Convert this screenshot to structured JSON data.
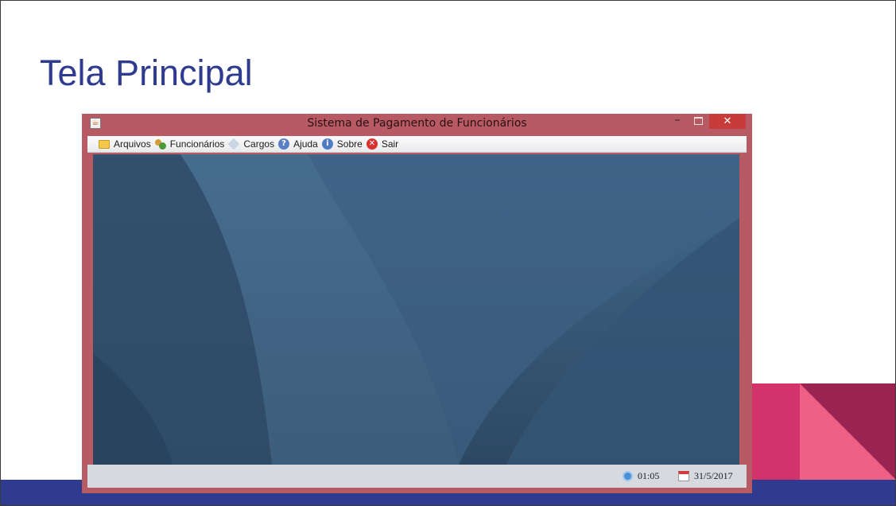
{
  "slide": {
    "title": "Tela Principal"
  },
  "window": {
    "title": "Sistema de Pagamento de Funcionários",
    "close_glyph": "✕",
    "minimize_glyph": "–"
  },
  "menu": {
    "items": [
      {
        "label": "Arquivos",
        "icon": "folder-icon"
      },
      {
        "label": "Funcionários",
        "icon": "users-icon"
      },
      {
        "label": "Cargos",
        "icon": "tag-icon"
      },
      {
        "label": "Ajuda",
        "icon": "help-icon"
      },
      {
        "label": "Sobre",
        "icon": "info-icon"
      },
      {
        "label": "Sair",
        "icon": "exit-icon"
      }
    ]
  },
  "status": {
    "time": "01:05",
    "date": "31/5/2017"
  },
  "colors": {
    "title": "#2e3b8f",
    "window_frame": "#b85a64",
    "close_button": "#c83b3b",
    "desktop": "#3b5a78",
    "band": "#2e3b8f",
    "accent_pink": "#d3336a"
  }
}
